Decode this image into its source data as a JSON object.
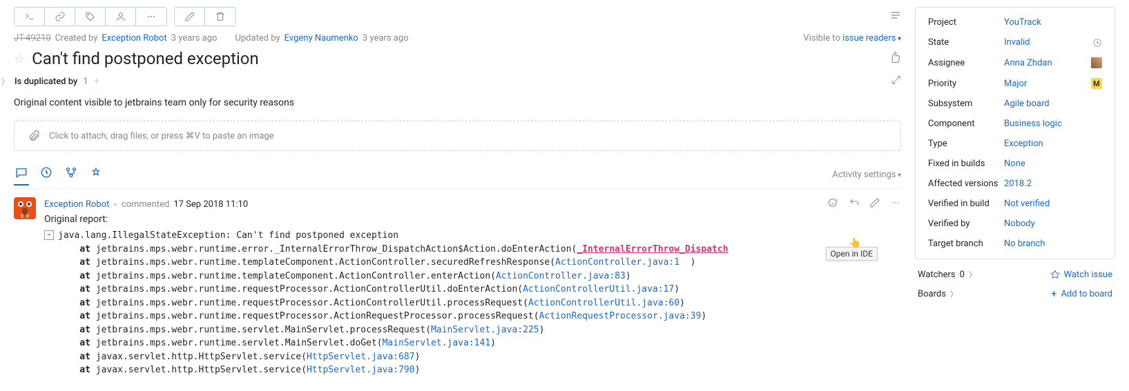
{
  "issue": {
    "id": "JT-49210",
    "title": "Can't find postponed exception",
    "created_by_label": "Created by",
    "created_by": "Exception Robot",
    "created_ago": "3 years ago",
    "updated_by_label": "Updated by",
    "updated_by": "Evgeny Naumenko",
    "updated_ago": "3 years ago",
    "visible_to_label": "Visible to",
    "visible_to": "issue readers"
  },
  "links": {
    "label": "Is duplicated by",
    "count": "1"
  },
  "security_note": "Original content visible to jetbrains team only for security reasons",
  "attach_placeholder": "Click to attach, drag files, or press ⌘V to paste an image",
  "activity": {
    "settings_label": "Activity settings"
  },
  "comment": {
    "author": "Exception Robot",
    "verb": "commented",
    "time": "17 Sep 2018 11:10",
    "original_report": "Original report:",
    "exception_header": "java.lang.IllegalStateException: Can't find postponed exception",
    "ide_tooltip": "Open in IDE",
    "stack": [
      {
        "prefix": "jetbrains.mps.webr.runtime.error._InternalErrorThrow_DispatchAction$Action.doEnterAction(",
        "link": "_InternalErrorThrow_Dispatch",
        "hot": true,
        "trailing": ""
      },
      {
        "prefix": "jetbrains.mps.webr.runtime.templateComponent.ActionController.securedRefreshResponse(",
        "link": "ActionController.java:1",
        "trailing": "  )"
      },
      {
        "prefix": "jetbrains.mps.webr.runtime.templateComponent.ActionController.enterAction(",
        "link": "ActionController.java:83",
        "trailing": ")"
      },
      {
        "prefix": "jetbrains.mps.webr.runtime.requestProcessor.ActionControllerUtil.doEnterAction(",
        "link": "ActionControllerUtil.java:17",
        "trailing": ")"
      },
      {
        "prefix": "jetbrains.mps.webr.runtime.requestProcessor.ActionControllerUtil.processRequest(",
        "link": "ActionControllerUtil.java:60",
        "trailing": ")"
      },
      {
        "prefix": "jetbrains.mps.webr.runtime.requestProcessor.ActionRequestProcessor.processRequest(",
        "link": "ActionRequestProcessor.java:39",
        "trailing": ")"
      },
      {
        "prefix": "jetbrains.mps.webr.runtime.servlet.MainServlet.processRequest(",
        "link": "MainServlet.java:225",
        "trailing": ")"
      },
      {
        "prefix": "jetbrains.mps.webr.runtime.servlet.MainServlet.doGet(",
        "link": "MainServlet.java:141",
        "trailing": ")"
      },
      {
        "prefix": "javax.servlet.http.HttpServlet.service(",
        "link": "HttpServlet.java:687",
        "trailing": ")"
      },
      {
        "prefix": "javax.servlet.http.HttpServlet.service(",
        "link": "HttpServlet.java:790",
        "trailing": ")"
      }
    ]
  },
  "fields": [
    {
      "label": "Project",
      "value": "YouTrack",
      "icon": ""
    },
    {
      "label": "State",
      "value": "Invalid",
      "icon": "history"
    },
    {
      "label": "Assignee",
      "value": "Anna Zhdan",
      "icon": "avatar"
    },
    {
      "label": "Priority",
      "value": "Major",
      "icon": "M"
    },
    {
      "label": "Subsystem",
      "value": "Agile board",
      "icon": ""
    },
    {
      "label": "Component",
      "value": "Business logic",
      "icon": ""
    },
    {
      "label": "Type",
      "value": "Exception",
      "icon": ""
    },
    {
      "label": "Fixed in builds",
      "value": "None",
      "icon": ""
    },
    {
      "label": "Affected versions",
      "value": "2018.2",
      "icon": ""
    },
    {
      "label": "Verified in build",
      "value": "Not verified",
      "icon": ""
    },
    {
      "label": "Verified by",
      "value": "Nobody",
      "icon": ""
    },
    {
      "label": "Target branch",
      "value": "No branch",
      "icon": ""
    }
  ],
  "watchers": {
    "label": "Watchers",
    "count": "0",
    "action": "Watch issue"
  },
  "boards": {
    "label": "Boards",
    "action": "Add to board"
  }
}
